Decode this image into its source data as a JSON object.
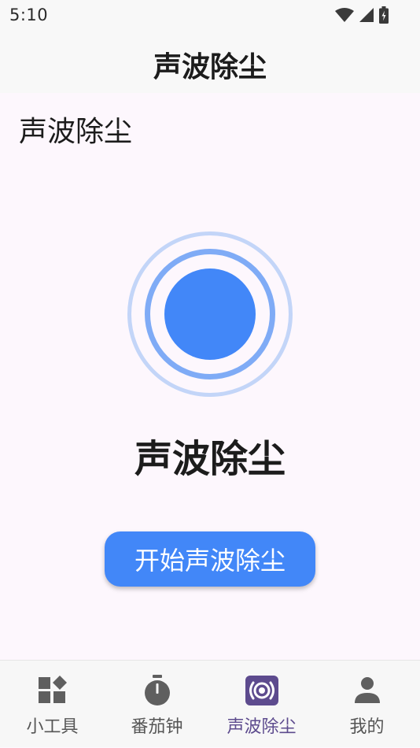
{
  "status_bar": {
    "time": "5:10",
    "icons": [
      "wifi-icon",
      "signal-icon",
      "battery-icon"
    ]
  },
  "app_bar": {
    "title": "声波除尘"
  },
  "main": {
    "section_title": "声波除尘",
    "hero_title": "声波除尘",
    "start_button_label": "开始声波除尘",
    "graphic": {
      "outer_ring_color": "#c3d5f8",
      "middle_ring_color": "#7fabf6",
      "core_color": "#4287f8"
    }
  },
  "bottom_nav": {
    "items": [
      {
        "label": "小工具",
        "icon": "widgets-icon",
        "active": false
      },
      {
        "label": "番茄钟",
        "icon": "timer-icon",
        "active": false
      },
      {
        "label": "声波除尘",
        "icon": "sound-wave-icon",
        "active": true
      },
      {
        "label": "我的",
        "icon": "person-icon",
        "active": false
      }
    ]
  },
  "colors": {
    "accent": "#4287f8",
    "background": "#fdf7fd",
    "active_nav": "#5d4b8e",
    "inactive_nav": "#555555"
  }
}
